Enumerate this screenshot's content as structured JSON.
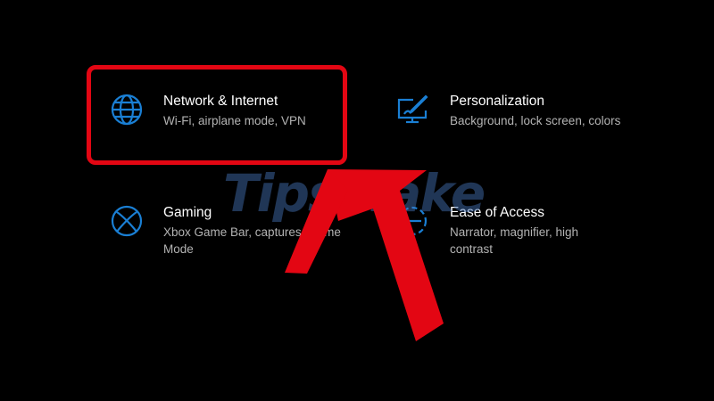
{
  "settings_tiles": [
    {
      "title": "Network & Internet",
      "description": "Wi-Fi, airplane mode, VPN",
      "icon": "globe-icon"
    },
    {
      "title": "Personalization",
      "description": "Background, lock screen, colors",
      "icon": "paint-monitor-icon"
    },
    {
      "title": "Gaming",
      "description": "Xbox Game Bar, captures, Game Mode",
      "icon": "xbox-icon"
    },
    {
      "title": "Ease of Access",
      "description": "Narrator, magnifier, high contrast",
      "icon": "ease-of-access-icon"
    }
  ],
  "watermark": "TipsMake",
  "colors": {
    "accent": "#1a7fd4",
    "highlight": "#e30613",
    "background": "#000000"
  }
}
